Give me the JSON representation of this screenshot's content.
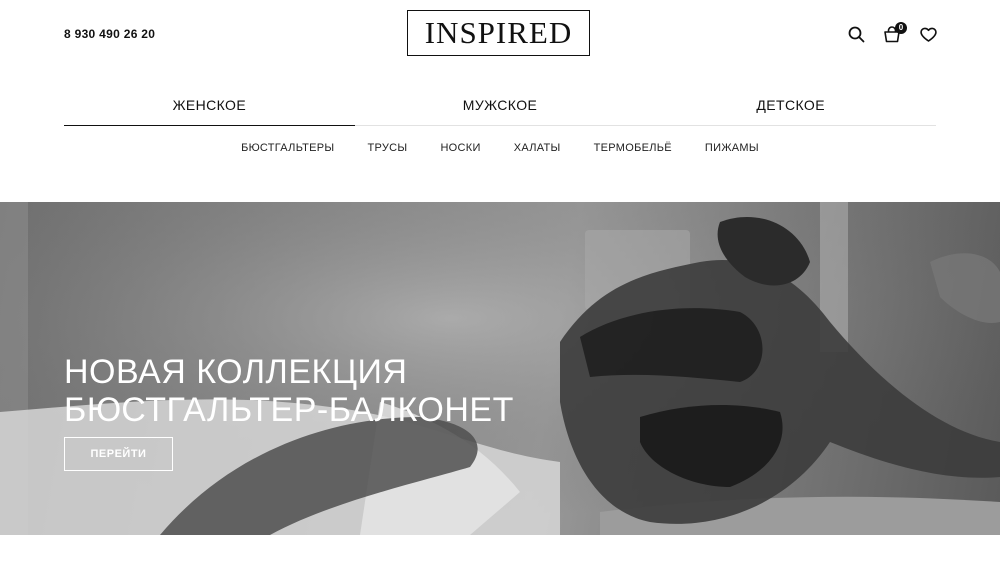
{
  "header": {
    "phone": "8 930 490 26 20",
    "logo": "INSPIRED",
    "cart_count": "0",
    "icons": [
      "search-icon",
      "cart-icon",
      "heart-icon"
    ]
  },
  "gender_nav": {
    "items": [
      {
        "label": "ЖЕНСКОЕ",
        "active": true
      },
      {
        "label": "МУЖСКОЕ",
        "active": false
      },
      {
        "label": "ДЕТСКОЕ",
        "active": false
      }
    ]
  },
  "category_nav": {
    "items": [
      "БЮСТГАЛЬТЕРЫ",
      "ТРУСЫ",
      "НОСКИ",
      "ХАЛАТЫ",
      "ТЕРМОБЕЛЬЁ",
      "ПИЖАМЫ"
    ]
  },
  "hero": {
    "title_line1": "НОВАЯ КОЛЛЕКЦИЯ",
    "title_line2": "БЮСТГАЛЬТЕР-БАЛКОНЕТ",
    "button_label": "ПЕРЕЙТИ"
  },
  "colors": {
    "text": "#111111",
    "background": "#ffffff",
    "hero_text": "#ffffff"
  }
}
